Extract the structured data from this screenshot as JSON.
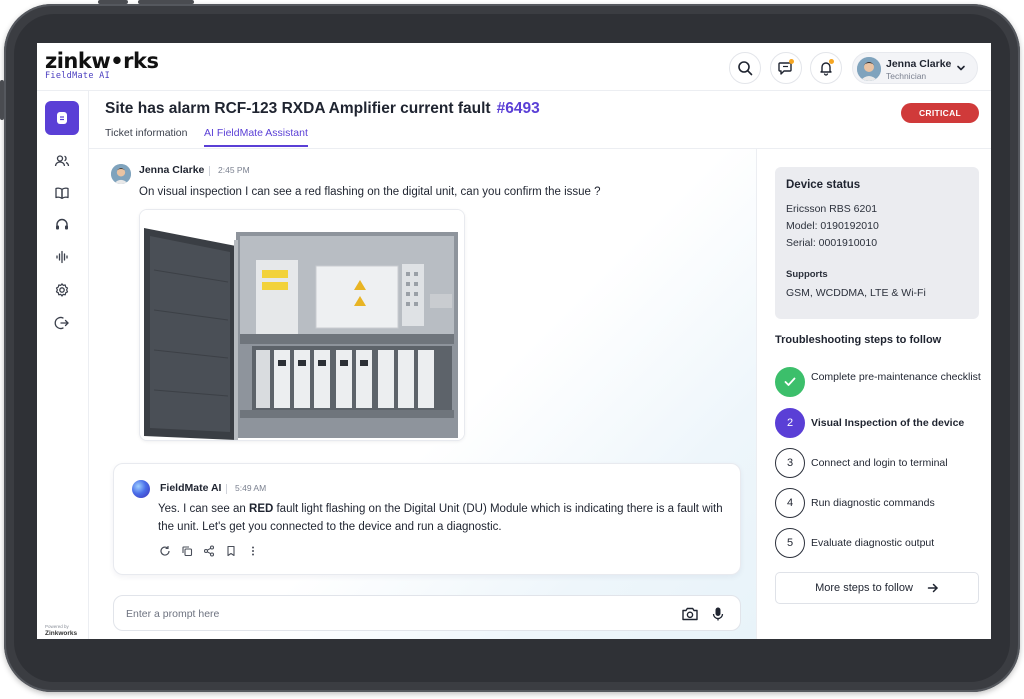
{
  "header": {
    "logo_main": "zinkw•rks",
    "logo_sub": "FieldMate AI",
    "user": {
      "name": "Jenna Clarke",
      "role": "Technician"
    }
  },
  "rail": {
    "powered_by": "Powered by",
    "powered_name": "Zinkworks"
  },
  "ticket": {
    "title": "Site has alarm RCF-123 RXDA Amplifier current fault",
    "number": "#6493",
    "severity": "CRITICAL",
    "tabs": [
      {
        "label": "Ticket information",
        "active": false
      },
      {
        "label": "AI FieldMate Assistant",
        "active": true
      }
    ]
  },
  "chat": {
    "user_message": {
      "author": "Jenna Clarke",
      "time": "2:45 PM",
      "text": "On visual inspection I can see a red flashing on the digital unit, can you confirm the issue ?"
    },
    "ai_message": {
      "author": "FieldMate AI",
      "time": "5:49 AM",
      "text_pre": "Yes. I can see an ",
      "text_bold": "RED",
      "text_post": " fault light flashing on the Digital Unit (DU) Module which is indicating there is a fault with the unit. Let's get you connected to the device and run a diagnostic."
    },
    "prompt_placeholder": "Enter a prompt here"
  },
  "device_status": {
    "title": "Device status",
    "name": "Ericsson RBS 6201",
    "model": "Model: 0190192010",
    "serial": "Serial: 0001910010",
    "supports_label": "Supports",
    "supports": "GSM, WCDDMA, LTE & Wi-Fi"
  },
  "troubleshooting": {
    "title": "Troubleshooting steps to follow",
    "steps": [
      {
        "num": "1",
        "label": "Complete pre-maintenance checklist",
        "state": "done"
      },
      {
        "num": "2",
        "label": "Visual Inspection of the device",
        "state": "active"
      },
      {
        "num": "3",
        "label": "Connect and login to terminal",
        "state": "pending"
      },
      {
        "num": "4",
        "label": "Run diagnostic commands",
        "state": "pending"
      },
      {
        "num": "5",
        "label": "Evaluate diagnostic output",
        "state": "pending"
      }
    ],
    "more_label": "More steps to follow"
  },
  "colors": {
    "accent": "#5a3fd6",
    "critical": "#d03a3a",
    "done": "#3cbf6b"
  }
}
